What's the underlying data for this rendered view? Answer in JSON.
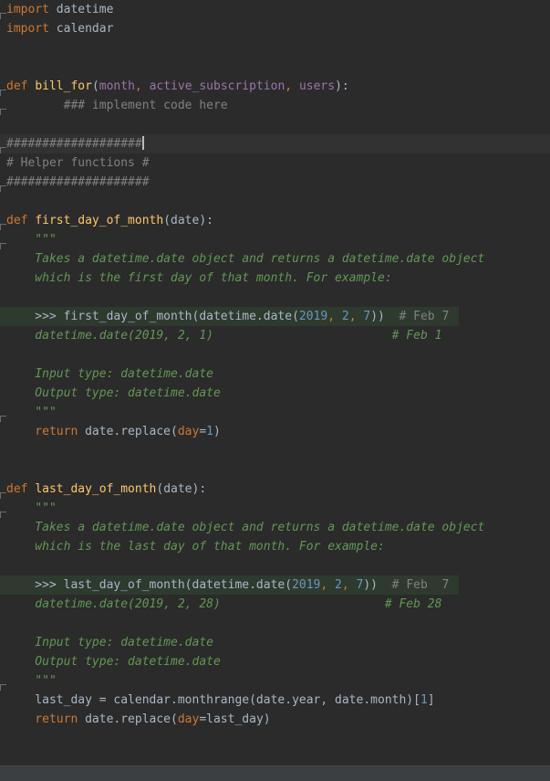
{
  "colors": {
    "background": "#2b2b2b",
    "keyword": "#cc7832",
    "function_name": "#ffc66d",
    "parameter": "#9876aa",
    "comment": "#808080",
    "docstring": "#629755",
    "number": "#6897bb",
    "text": "#a9b7c6"
  },
  "editor": {
    "lines": [
      [
        [
          "kw",
          "import"
        ],
        [
          "plain",
          " datetime"
        ]
      ],
      [
        [
          "kw",
          "import"
        ],
        [
          "plain",
          " calendar"
        ]
      ],
      [],
      [],
      [
        [
          "kw",
          "def "
        ],
        [
          "fn",
          "bill_for"
        ],
        [
          "plain",
          "("
        ],
        [
          "param",
          "month"
        ],
        [
          "kw",
          ", "
        ],
        [
          "param",
          "active_subscription"
        ],
        [
          "kw",
          ", "
        ],
        [
          "param",
          "users"
        ],
        [
          "plain",
          "):"
        ]
      ],
      [
        [
          "todo",
          "        ### implement code here"
        ]
      ],
      [],
      [
        [
          "comment",
          "###################"
        ],
        [
          "caret",
          ""
        ]
      ],
      [
        [
          "comment",
          "# Helper functions #"
        ]
      ],
      [
        [
          "comment",
          "####################"
        ]
      ],
      [],
      [
        [
          "kw",
          "def "
        ],
        [
          "fn",
          "first_day_of_month"
        ],
        [
          "plain",
          "(date):"
        ]
      ],
      [
        [
          "doc",
          "    \"\"\""
        ]
      ],
      [
        [
          "doc",
          "    Takes a datetime.date object and returns a datetime.date object"
        ]
      ],
      [
        [
          "doc",
          "    which is the first day of that month. For example:"
        ]
      ],
      [],
      [
        [
          "plain",
          "    >>> first_day_of_month(datetime.date("
        ],
        [
          "num",
          "2019"
        ],
        [
          "kw",
          ", "
        ],
        [
          "num",
          "2"
        ],
        [
          "kw",
          ", "
        ],
        [
          "num",
          "7"
        ],
        [
          "plain",
          "))  "
        ],
        [
          "comment",
          "# Feb 7"
        ]
      ],
      [
        [
          "doc",
          "    datetime.date(2019, 2, 1)                         # Feb 1"
        ]
      ],
      [],
      [
        [
          "doc",
          "    Input type: datetime.date"
        ]
      ],
      [
        [
          "doc",
          "    Output type: datetime.date"
        ]
      ],
      [
        [
          "doc",
          "    \"\"\""
        ]
      ],
      [
        [
          "kw",
          "    return "
        ],
        [
          "plain",
          "date.replace("
        ],
        [
          "kw",
          "day"
        ],
        [
          "plain",
          "="
        ],
        [
          "num",
          "1"
        ],
        [
          "plain",
          ")"
        ]
      ],
      [],
      [],
      [
        [
          "kw",
          "def "
        ],
        [
          "fn",
          "last_day_of_month"
        ],
        [
          "plain",
          "(date):"
        ]
      ],
      [
        [
          "doc",
          "    \"\"\""
        ]
      ],
      [
        [
          "doc",
          "    Takes a datetime.date object and returns a datetime.date object"
        ]
      ],
      [
        [
          "doc",
          "    which is the last day of that month. For example:"
        ]
      ],
      [],
      [
        [
          "plain",
          "    >>> last_day_of_month(datetime.date("
        ],
        [
          "num",
          "2019"
        ],
        [
          "kw",
          ", "
        ],
        [
          "num",
          "2"
        ],
        [
          "kw",
          ", "
        ],
        [
          "num",
          "7"
        ],
        [
          "plain",
          "))  "
        ],
        [
          "comment",
          "# Feb  7"
        ]
      ],
      [
        [
          "doc",
          "    datetime.date(2019, 2, 28)                       # Feb 28"
        ]
      ],
      [],
      [
        [
          "doc",
          "    Input type: datetime.date"
        ]
      ],
      [
        [
          "doc",
          "    Output type: datetime.date"
        ]
      ],
      [
        [
          "doc",
          "    \"\"\""
        ]
      ],
      [
        [
          "plain",
          "    last_day = calendar.monthrange(date.year, date.month)["
        ],
        [
          "num",
          "1"
        ],
        [
          "plain",
          "]"
        ]
      ],
      [
        [
          "kw",
          "    return "
        ],
        [
          "plain",
          "date.replace("
        ],
        [
          "kw",
          "day"
        ],
        [
          "plain",
          "=last_day)"
        ]
      ]
    ]
  }
}
